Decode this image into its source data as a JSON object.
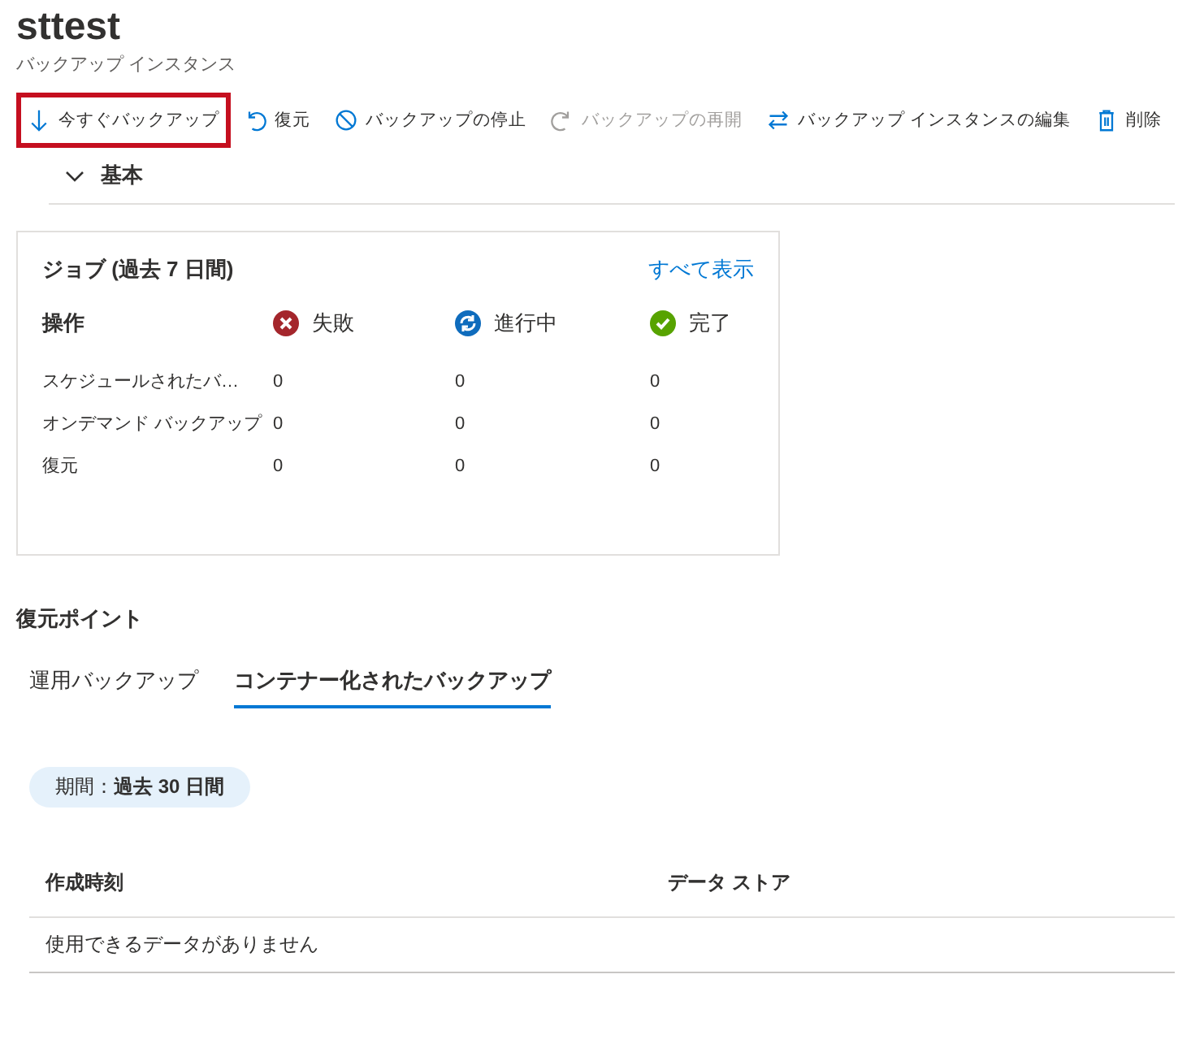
{
  "header": {
    "title": "sttest",
    "subtitle": "バックアップ インスタンス"
  },
  "toolbar": [
    {
      "kind": "backup",
      "label": "今すぐバックアップ",
      "disabled": false,
      "highlighted": true
    },
    {
      "kind": "restore",
      "label": "復元",
      "disabled": false,
      "highlighted": false
    },
    {
      "kind": "stop",
      "label": "バックアップの停止",
      "disabled": false,
      "highlighted": false
    },
    {
      "kind": "resume",
      "label": "バックアップの再開",
      "disabled": true,
      "highlighted": false
    },
    {
      "kind": "edit",
      "label": "バックアップ インスタンスの編集",
      "disabled": false,
      "highlighted": false
    },
    {
      "kind": "delete",
      "label": "削除",
      "disabled": false,
      "highlighted": false
    }
  ],
  "essentials": {
    "label": "基本",
    "expanded": false
  },
  "jobs": {
    "title": "ジョブ (過去 7 日間)",
    "link": "すべて表示",
    "operation_header": "操作",
    "statuses": [
      {
        "kind": "failed",
        "label": "失敗"
      },
      {
        "kind": "progress",
        "label": "進行中"
      },
      {
        "kind": "done",
        "label": "完了"
      }
    ],
    "rows": [
      {
        "name": "スケジュールされたバ…",
        "values": [
          "0",
          "0",
          "0"
        ]
      },
      {
        "name": "オンデマンド バックアップ",
        "values": [
          "0",
          "0",
          "0"
        ]
      },
      {
        "name": "復元",
        "values": [
          "0",
          "0",
          "0"
        ]
      }
    ]
  },
  "restore_points": {
    "title": "復元ポイント",
    "tabs": [
      {
        "label": "運用バックアップ",
        "selected": false
      },
      {
        "label": "コンテナー化されたバックアップ",
        "selected": true
      }
    ],
    "filter": "期間：**過去 30 日間**",
    "columns": [
      "作成時刻",
      "データ ストア"
    ],
    "empty": "使用できるデータがありません"
  }
}
